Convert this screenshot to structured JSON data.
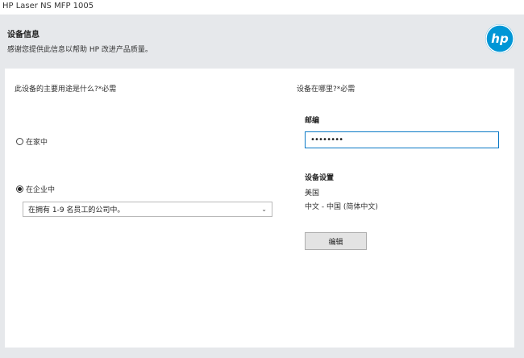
{
  "window": {
    "title": "HP Laser NS MFP 1005"
  },
  "header": {
    "heading": "设备信息",
    "subheading": "感谢您提供此信息以帮助 HP 改进产品质量。"
  },
  "left": {
    "question": "此设备的主要用途是什么?*必需",
    "options": [
      {
        "label": "在家中",
        "checked": false
      },
      {
        "label": "在企业中",
        "checked": true
      }
    ],
    "company_size_select": {
      "value": "在拥有 1-9 名员工的公司中。"
    }
  },
  "right": {
    "question": "设备在哪里?*必需",
    "postal_label": "邮编",
    "postal_value": "••••••••",
    "settings_heading": "设备设置",
    "country": "美国",
    "language": "中文 - 中国 (简体中文)",
    "edit_label": "编辑"
  },
  "colors": {
    "hp_blue": "#0096d6",
    "focus_border": "#0a79c6"
  }
}
